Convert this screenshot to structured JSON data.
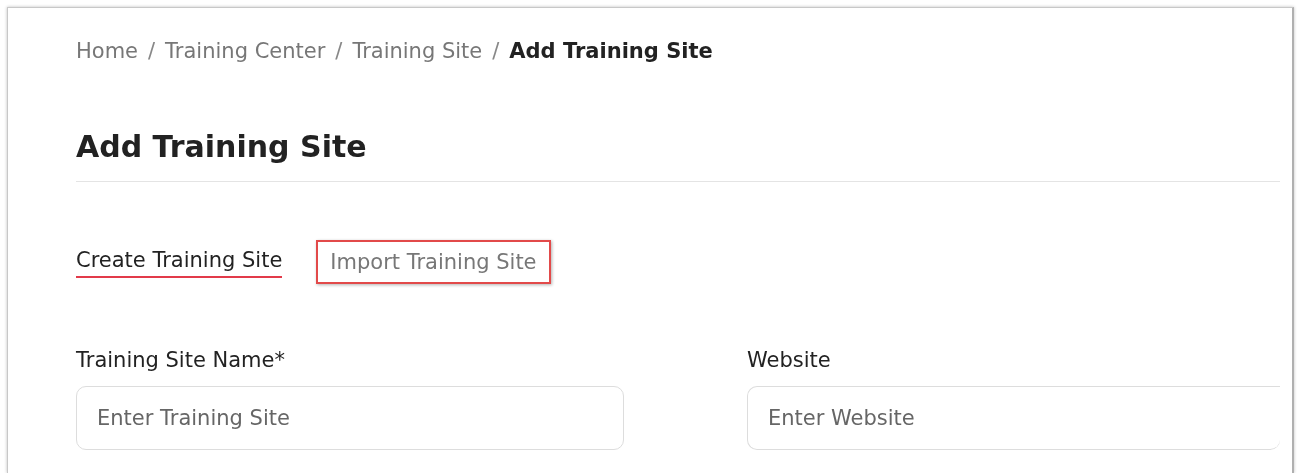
{
  "breadcrumb": [
    {
      "label": "Home",
      "current": false
    },
    {
      "label": "Training Center",
      "current": false
    },
    {
      "label": "Training Site",
      "current": false
    },
    {
      "label": "Add Training Site",
      "current": true
    }
  ],
  "breadcrumb_separator": "/",
  "title": "Add Training Site",
  "tabs": [
    {
      "label": "Create Training Site",
      "selected": true,
      "highlighted": false
    },
    {
      "label": "Import Training Site",
      "selected": false,
      "highlighted": true
    }
  ],
  "fields": [
    {
      "label": "Training Site Name*",
      "placeholder": "Enter Training Site"
    },
    {
      "label": "Website",
      "placeholder": "Enter Website"
    }
  ]
}
